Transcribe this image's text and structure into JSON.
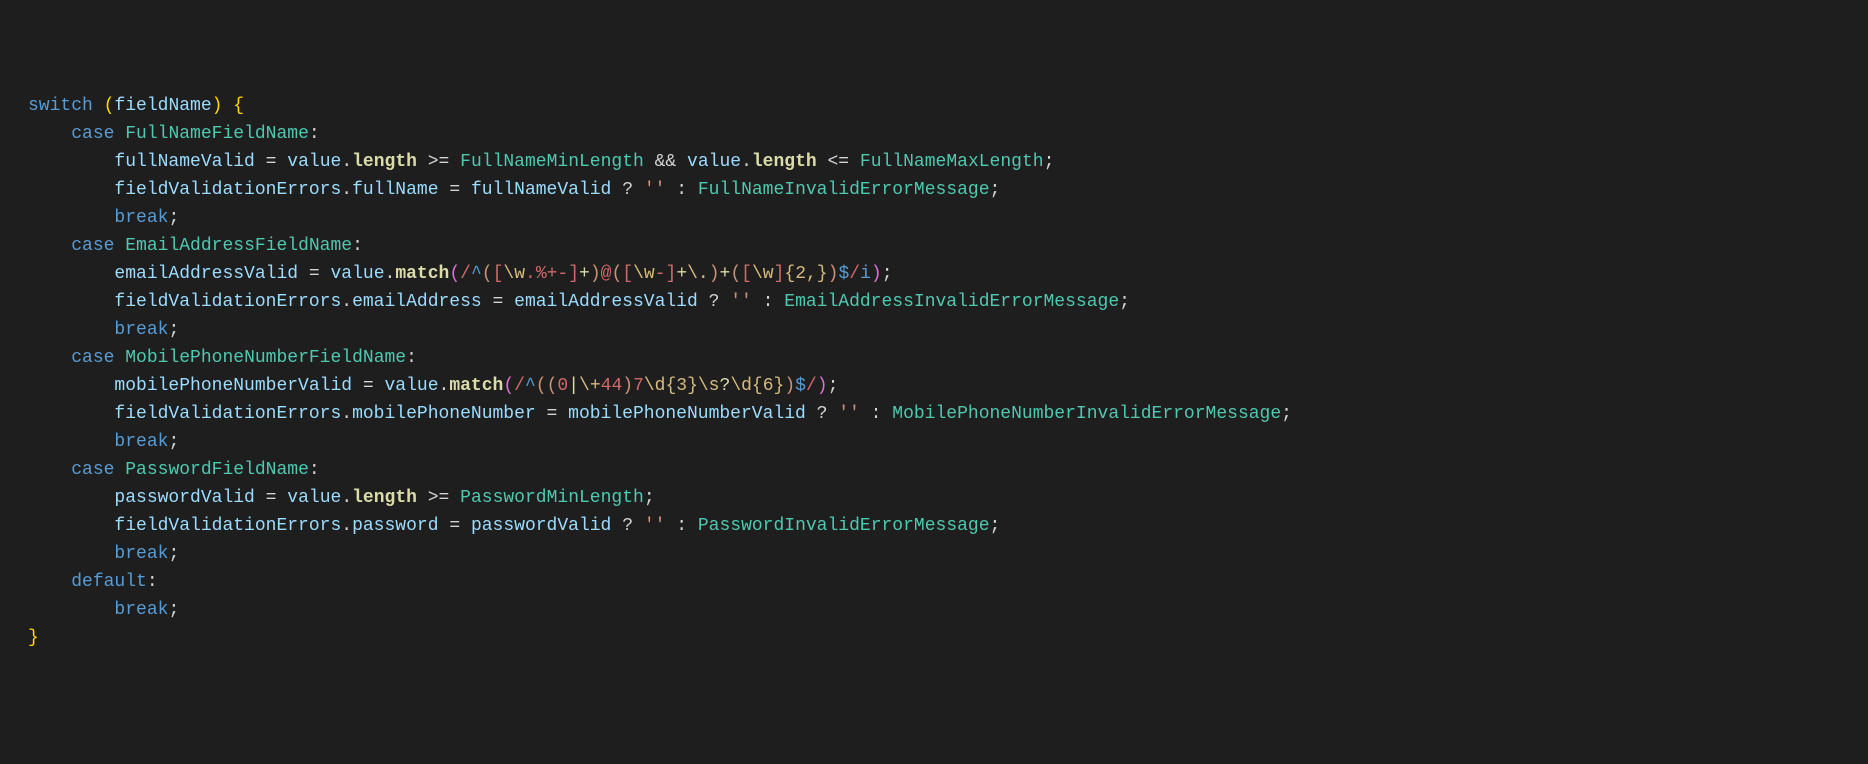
{
  "kw": {
    "switch": "switch",
    "case": "case",
    "break": "break",
    "default": "default"
  },
  "id": {
    "fieldName": "fieldName",
    "FullNameFieldName": "FullNameFieldName",
    "fullNameValid": "fullNameValid",
    "value": "value",
    "length": "length",
    "FullNameMinLength": "FullNameMinLength",
    "FullNameMaxLength": "FullNameMaxLength",
    "fieldValidationErrors": "fieldValidationErrors",
    "fullName": "fullName",
    "FullNameInvalidErrorMessage": "FullNameInvalidErrorMessage",
    "EmailAddressFieldName": "EmailAddressFieldName",
    "emailAddressValid": "emailAddressValid",
    "match": "match",
    "emailAddress": "emailAddress",
    "EmailAddressInvalidErrorMessage": "EmailAddressInvalidErrorMessage",
    "MobilePhoneNumberFieldName": "MobilePhoneNumberFieldName",
    "mobilePhoneNumberValid": "mobilePhoneNumberValid",
    "mobilePhoneNumber": "mobilePhoneNumber",
    "MobilePhoneNumberInvalidErrorMessage": "MobilePhoneNumberInvalidErrorMessage",
    "PasswordFieldName": "PasswordFieldName",
    "passwordValid": "passwordValid",
    "PasswordMinLength": "PasswordMinLength",
    "password": "password",
    "PasswordInvalidErrorMessage": "PasswordInvalidErrorMessage"
  },
  "str": {
    "empty": "''"
  },
  "regex": {
    "email": "/^([\\w.%+-]+)@([\\w-]+\\.)+([\\w]{2,})$/i",
    "phone": "/^((0|\\+44)7\\d{3}\\s?\\d{6})$/"
  }
}
